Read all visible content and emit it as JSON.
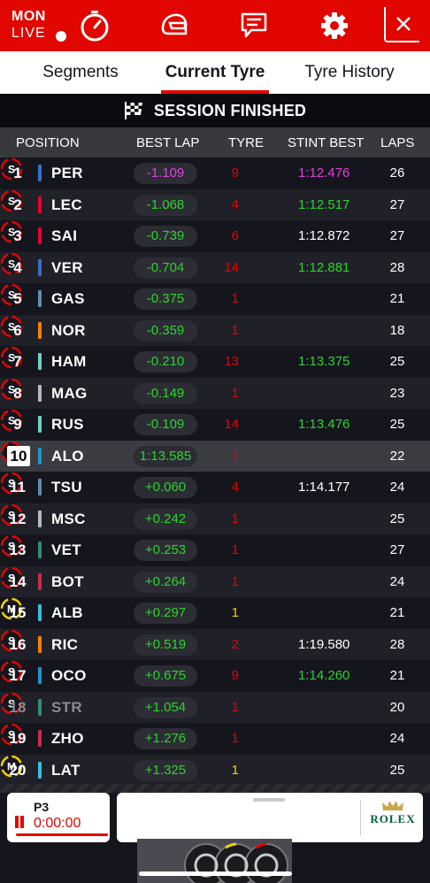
{
  "header": {
    "location": "MON",
    "live_label": "LIVE",
    "icons": [
      "timer-icon",
      "helmet-icon",
      "message-icon",
      "gear-icon",
      "close-icon"
    ],
    "accent_color": "#e10600"
  },
  "tabs": [
    {
      "label": "Segments",
      "active": false
    },
    {
      "label": "Current Tyre",
      "active": true
    },
    {
      "label": "Tyre History",
      "active": false
    }
  ],
  "banner": {
    "text": "SESSION FINISHED",
    "icon": "chequered-flag-icon"
  },
  "columns": {
    "position": "POSITION",
    "best_lap": "BEST LAP",
    "tyre": "TYRE",
    "stint_best": "STINT BEST",
    "laps": "LAPS"
  },
  "rows": [
    {
      "pos": "1",
      "code": "PER",
      "team_color": "#3671c6",
      "best_lap": "-1.109",
      "best_lap_color": "#e040e0",
      "tyre_laps": "9",
      "compound": "S",
      "stint_best": "1:12.476",
      "stint_color": "#e040e0",
      "laps": "26"
    },
    {
      "pos": "2",
      "code": "LEC",
      "team_color": "#e8002d",
      "best_lap": "-1.068",
      "best_lap_color": "#2bd42b",
      "tyre_laps": "4",
      "compound": "S",
      "stint_best": "1:12.517",
      "stint_color": "#2bd42b",
      "laps": "27"
    },
    {
      "pos": "3",
      "code": "SAI",
      "team_color": "#e8002d",
      "best_lap": "-0.739",
      "best_lap_color": "#2bd42b",
      "tyre_laps": "6",
      "compound": "S",
      "stint_best": "1:12.872",
      "stint_color": "#ffffff",
      "laps": "27"
    },
    {
      "pos": "4",
      "code": "VER",
      "team_color": "#3671c6",
      "best_lap": "-0.704",
      "best_lap_color": "#2bd42b",
      "tyre_laps": "14",
      "compound": "S",
      "stint_best": "1:12.881",
      "stint_color": "#2bd42b",
      "laps": "28"
    },
    {
      "pos": "5",
      "code": "GAS",
      "team_color": "#5e8faa",
      "best_lap": "-0.375",
      "best_lap_color": "#2bd42b",
      "tyre_laps": "1",
      "compound": "S",
      "stint_best": "",
      "stint_color": "#ffffff",
      "laps": "21"
    },
    {
      "pos": "6",
      "code": "NOR",
      "team_color": "#ff8000",
      "best_lap": "-0.359",
      "best_lap_color": "#2bd42b",
      "tyre_laps": "1",
      "compound": "S",
      "stint_best": "",
      "stint_color": "#ffffff",
      "laps": "18"
    },
    {
      "pos": "7",
      "code": "HAM",
      "team_color": "#6cd3bf",
      "best_lap": "-0.210",
      "best_lap_color": "#2bd42b",
      "tyre_laps": "13",
      "compound": "S",
      "stint_best": "1:13.375",
      "stint_color": "#2bd42b",
      "laps": "25"
    },
    {
      "pos": "8",
      "code": "MAG",
      "team_color": "#b6babd",
      "best_lap": "-0.149",
      "best_lap_color": "#2bd42b",
      "tyre_laps": "1",
      "compound": "S",
      "stint_best": "",
      "stint_color": "#ffffff",
      "laps": "23"
    },
    {
      "pos": "9",
      "code": "RUS",
      "team_color": "#6cd3bf",
      "best_lap": "-0.109",
      "best_lap_color": "#2bd42b",
      "tyre_laps": "14",
      "compound": "S",
      "stint_best": "1:13.476",
      "stint_color": "#2bd42b",
      "laps": "25"
    },
    {
      "pos": "10",
      "code": "ALO",
      "team_color": "#2293d1",
      "best_lap": "1:13.585",
      "best_lap_color": "#2bd42b",
      "tyre_laps": "1",
      "compound": "S",
      "stint_best": "",
      "stint_color": "#ffffff",
      "laps": "22",
      "highlight": true
    },
    {
      "pos": "11",
      "code": "TSU",
      "team_color": "#5e8faa",
      "best_lap": "+0.060",
      "best_lap_color": "#2bd42b",
      "tyre_laps": "4",
      "compound": "S",
      "stint_best": "1:14.177",
      "stint_color": "#ffffff",
      "laps": "24"
    },
    {
      "pos": "12",
      "code": "MSC",
      "team_color": "#b6babd",
      "best_lap": "+0.242",
      "best_lap_color": "#2bd42b",
      "tyre_laps": "1",
      "compound": "S",
      "stint_best": "",
      "stint_color": "#ffffff",
      "laps": "25"
    },
    {
      "pos": "13",
      "code": "VET",
      "team_color": "#358c75",
      "best_lap": "+0.253",
      "best_lap_color": "#2bd42b",
      "tyre_laps": "1",
      "compound": "S",
      "stint_best": "",
      "stint_color": "#ffffff",
      "laps": "27"
    },
    {
      "pos": "14",
      "code": "BOT",
      "team_color": "#c92d4b",
      "best_lap": "+0.264",
      "best_lap_color": "#2bd42b",
      "tyre_laps": "1",
      "compound": "S",
      "stint_best": "",
      "stint_color": "#ffffff",
      "laps": "24"
    },
    {
      "pos": "15",
      "code": "ALB",
      "team_color": "#37bedd",
      "best_lap": "+0.297",
      "best_lap_color": "#2bd42b",
      "tyre_laps": "1",
      "compound": "M",
      "stint_best": "",
      "stint_color": "#ffffff",
      "laps": "21"
    },
    {
      "pos": "16",
      "code": "RIC",
      "team_color": "#ff8000",
      "best_lap": "+0.519",
      "best_lap_color": "#2bd42b",
      "tyre_laps": "2",
      "compound": "S",
      "stint_best": "1:19.580",
      "stint_color": "#ffffff",
      "laps": "28"
    },
    {
      "pos": "17",
      "code": "OCO",
      "team_color": "#2293d1",
      "best_lap": "+0.675",
      "best_lap_color": "#2bd42b",
      "tyre_laps": "9",
      "compound": "S",
      "stint_best": "1:14.260",
      "stint_color": "#2bd42b",
      "laps": "21"
    },
    {
      "pos": "18",
      "code": "STR",
      "team_color": "#358c75",
      "best_lap": "+1.054",
      "best_lap_color": "#2bd42b",
      "tyre_laps": "1",
      "compound": "S",
      "stint_best": "",
      "stint_color": "#ffffff",
      "laps": "20",
      "dim": true
    },
    {
      "pos": "19",
      "code": "ZHO",
      "team_color": "#c92d4b",
      "best_lap": "+1.276",
      "best_lap_color": "#2bd42b",
      "tyre_laps": "1",
      "compound": "S",
      "stint_best": "",
      "stint_color": "#ffffff",
      "laps": "24"
    },
    {
      "pos": "20",
      "code": "LAT",
      "team_color": "#37bedd",
      "best_lap": "+1.325",
      "best_lap_color": "#2bd42b",
      "tyre_laps": "1",
      "compound": "M",
      "stint_best": "",
      "stint_color": "#ffffff",
      "laps": "25"
    }
  ],
  "tyre_colors": {
    "S": "#e10600",
    "M": "#f5d000"
  },
  "bottom": {
    "session": "P3",
    "timer": "0:00:00",
    "sponsor": "ROLEX",
    "sponsor_color": "#006039"
  }
}
